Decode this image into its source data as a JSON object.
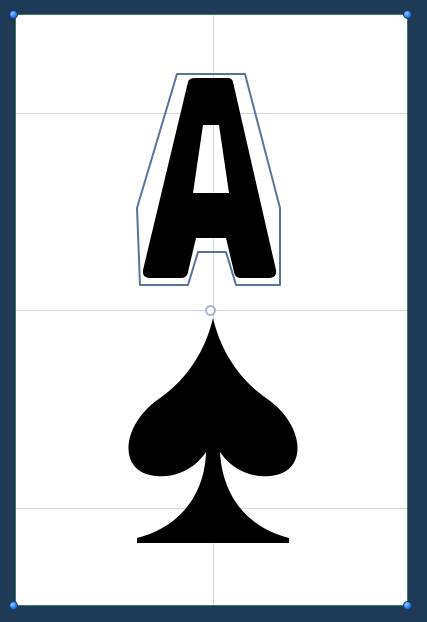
{
  "card": {
    "rank": "A",
    "suit": "spade-icon",
    "selected_layer": "rank-letter"
  },
  "colors": {
    "workspace": "#1f3a57",
    "card": "#ffffff",
    "ink": "#000000",
    "selection_outline": "#5b7399",
    "handle": "#2f7ee6",
    "guide": "#d4d8dd"
  }
}
